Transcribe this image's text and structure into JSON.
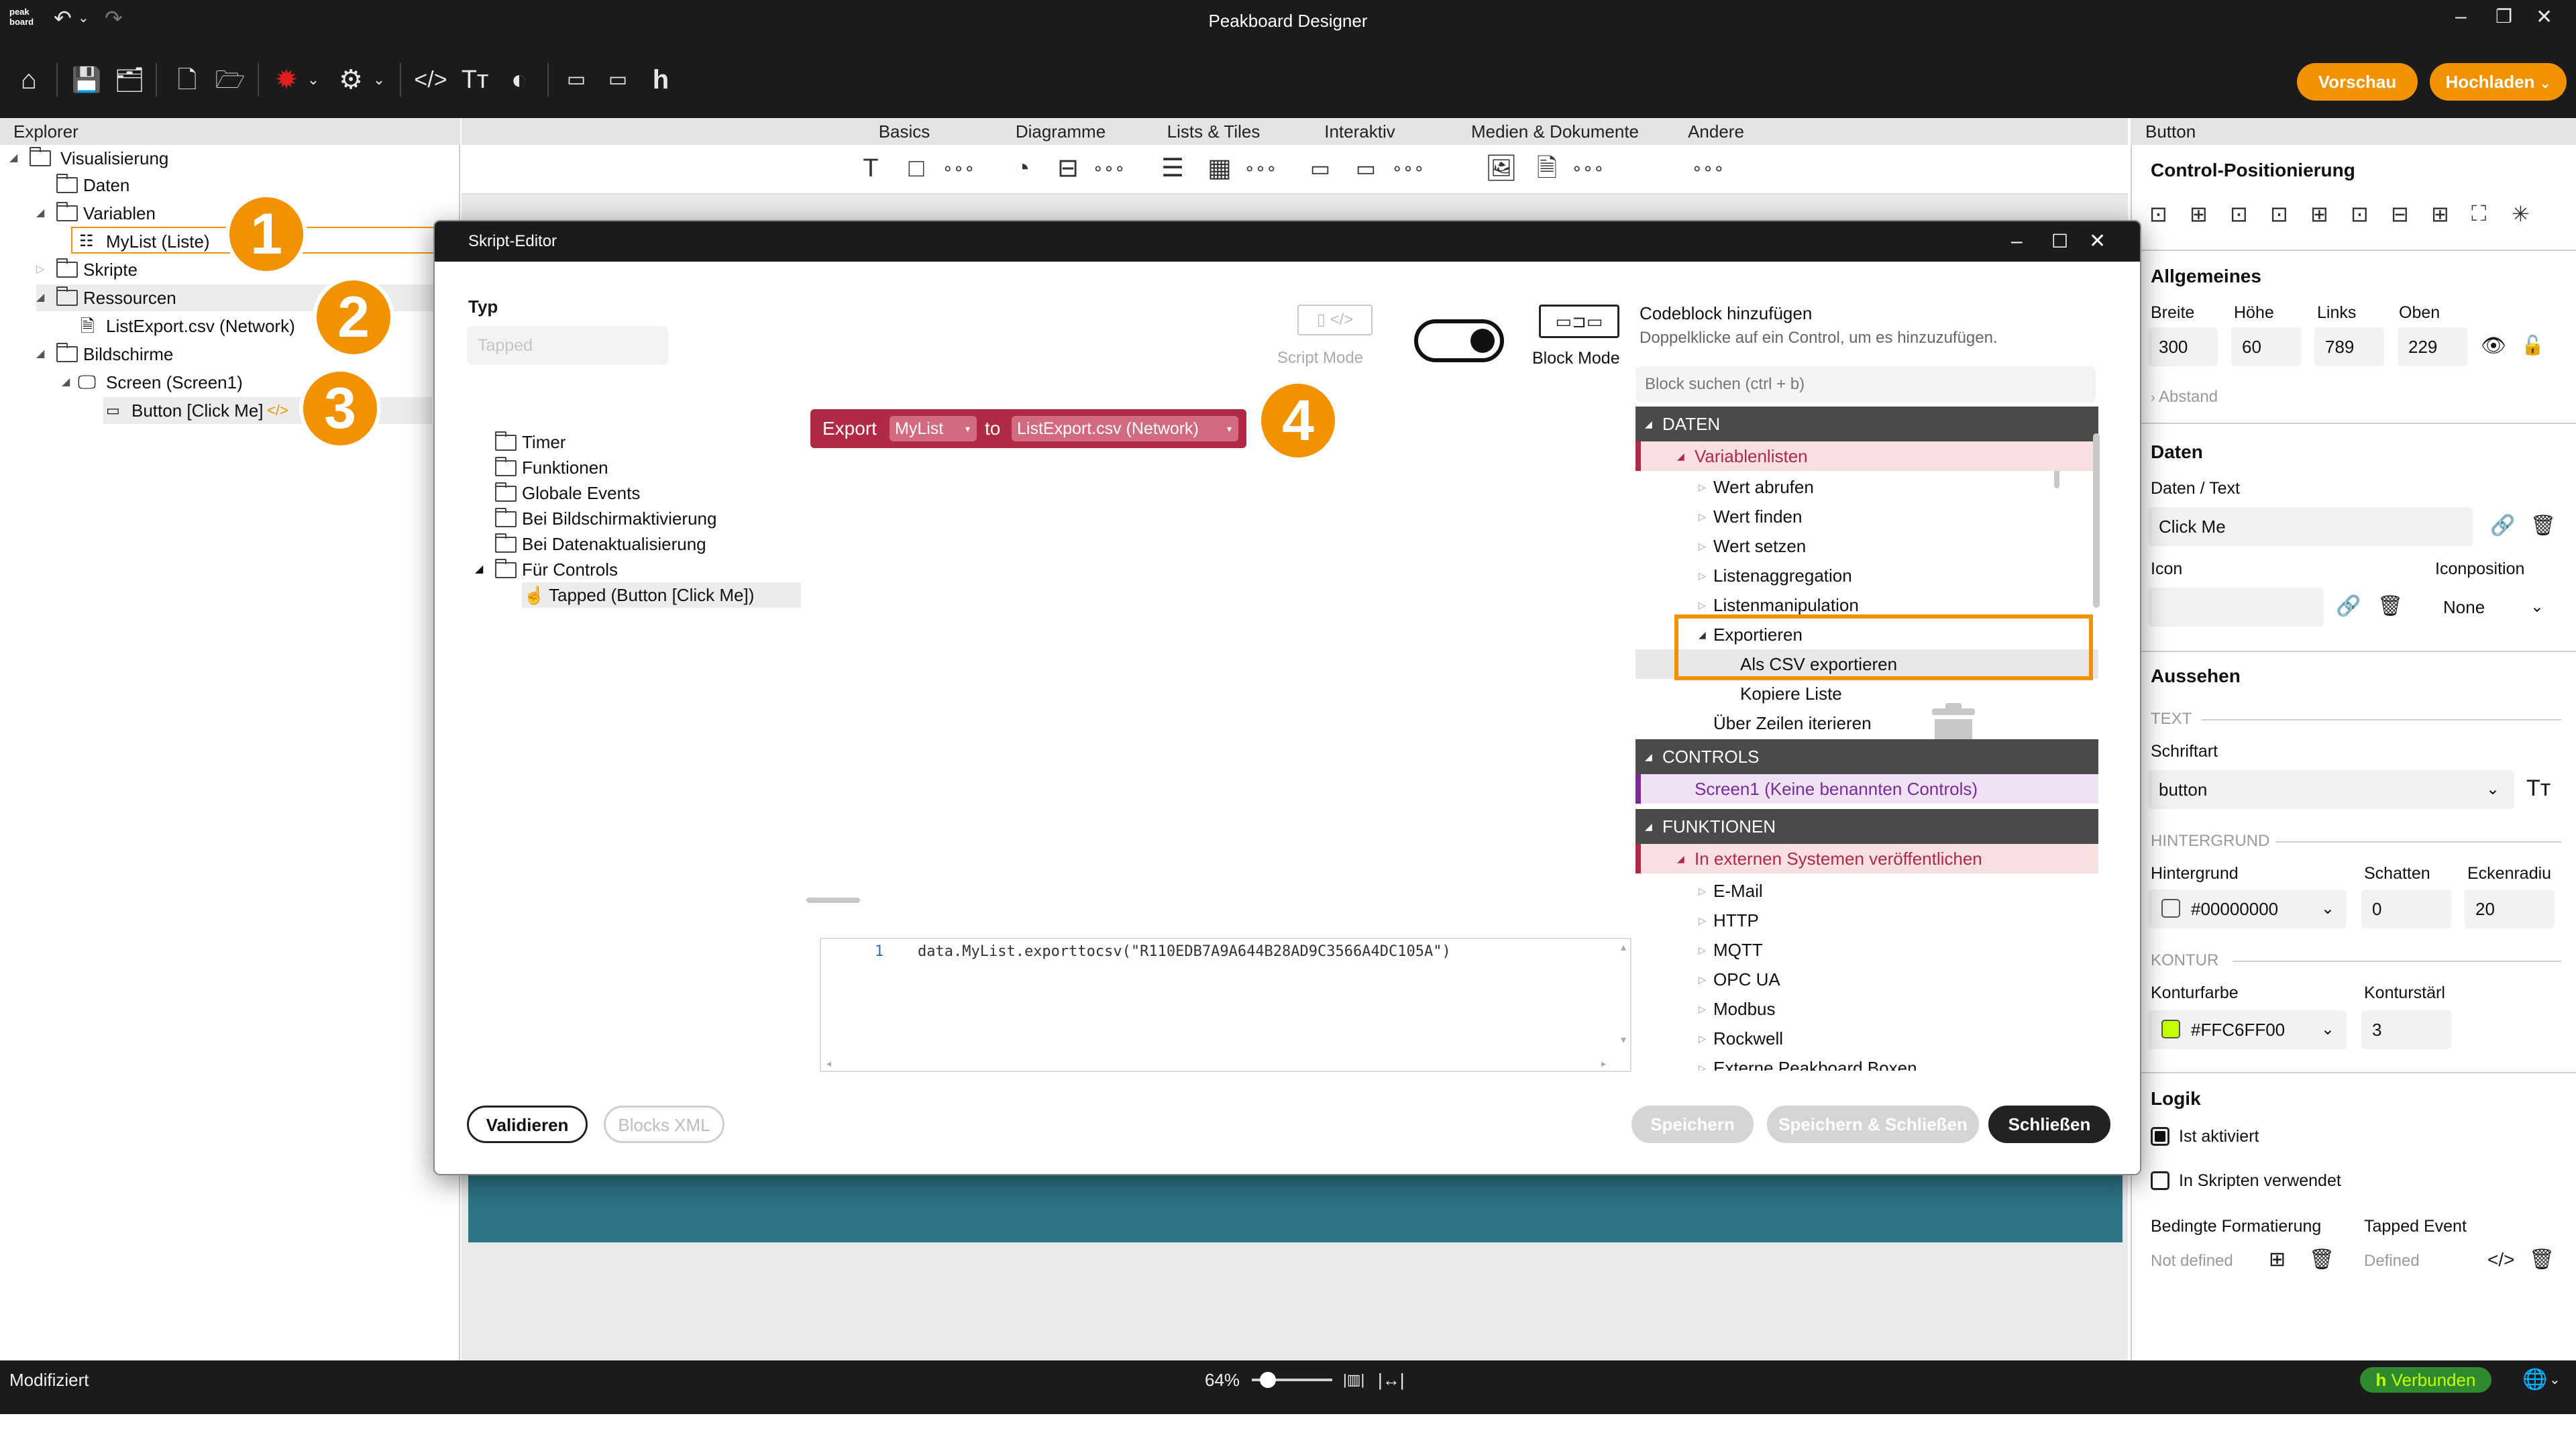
{
  "app": {
    "logo_text": "peak board",
    "title": "Peakboard Designer",
    "preview_label": "Vorschau",
    "upload_label": "Hochladen"
  },
  "explorer": {
    "header": "Explorer",
    "items": [
      {
        "label": "Visualisierung"
      },
      {
        "label": "Daten"
      },
      {
        "label": "Variablen"
      },
      {
        "label": "MyList (Liste)"
      },
      {
        "label": "Skripte"
      },
      {
        "label": "Ressourcen"
      },
      {
        "label": "ListExport.csv (Network)"
      },
      {
        "label": "Bildschirme"
      },
      {
        "label": "Screen (Screen1)"
      },
      {
        "label": "Button [Click Me]"
      }
    ],
    "markers": [
      "1",
      "2",
      "3"
    ]
  },
  "canvas_tabs": [
    "Basics",
    "Diagramme",
    "Lists & Tiles",
    "Interaktiv",
    "Medien & Dokumente",
    "Andere"
  ],
  "right_panel": {
    "header": "Button",
    "positioning_title": "Control-Positionierung",
    "general_title": "Allgemeines",
    "width_label": "Breite",
    "width": "300",
    "height_label": "Höhe",
    "height": "60",
    "left_label": "Links",
    "left": "789",
    "top_label": "Oben",
    "top": "229",
    "spacing_label": "Abstand",
    "data_title": "Daten",
    "data_text_label": "Daten / Text",
    "data_text": "Click Me",
    "icon_label": "Icon",
    "icon_position_label": "Iconposition",
    "icon_position": "None",
    "look_title": "Aussehen",
    "text_section": "TEXT",
    "font_label": "Schriftart",
    "font_value": "button",
    "bg_section": "HINTERGRUND",
    "bg_label": "Hintergrund",
    "bg_value": "#00000000",
    "shadow_label": "Schatten",
    "shadow_value": "0",
    "radius_label": "Eckenradiu",
    "radius_value": "20",
    "contour_section": "KONTUR",
    "contour_color_label": "Konturfarbe",
    "contour_color_value": "#FFC6FF00",
    "contour_width_label": "Konturstärl",
    "contour_width_value": "3",
    "logic_title": "Logik",
    "is_active": "Ist aktiviert",
    "in_scripts": "In Skripten verwendet",
    "cond_format_label": "Bedingte Formatierung",
    "cond_format_value": "Not defined",
    "tapped_event_label": "Tapped Event",
    "tapped_event_value": "Defined"
  },
  "status": {
    "left": "Modifiziert",
    "zoom": "64%",
    "connected": "Verbunden"
  },
  "script_editor": {
    "title": "Skript-Editor",
    "type_label": "Typ",
    "type_value": "Tapped",
    "script_mode": "Script Mode",
    "block_mode": "Block Mode",
    "add_block_title": "Codeblock hinzufügen",
    "add_block_hint": "Doppelklicke auf ein Control, um es hinzuzufügen.",
    "search_placeholder": "Block suchen (ctrl + b)",
    "event_tree": [
      "Timer",
      "Funktionen",
      "Globale Events",
      "Bei Bildschirmaktivierung",
      "Bei Datenaktualisierung",
      "Für Controls",
      "Tapped (Button [Click Me])"
    ],
    "block": {
      "keyword": "Export",
      "list": "MyList",
      "to": "to",
      "target": "ListExport.csv (Network)"
    },
    "marker4": "4",
    "code_line_no": "1",
    "code": "data.MyList.exporttocsv(\"R110EDB7A9A644B28AD9C3566A4DC105A\")",
    "categories": {
      "data": "DATEN",
      "variable_lists": "Variablenlisten",
      "data_items": [
        "Wert abrufen",
        "Wert finden",
        "Wert setzen",
        "Listenaggregation",
        "Listenmanipulation"
      ],
      "export": "Exportieren",
      "export_csv": "Als CSV exportieren",
      "copy_list": "Kopiere Liste",
      "iterate": "Über Zeilen iterieren",
      "controls": "CONTROLS",
      "screen1": "Screen1 (Keine benannten Controls)",
      "functions": "FUNKTIONEN",
      "publish": "In externen Systemen veröffentlichen",
      "publish_items": [
        "E-Mail",
        "HTTP",
        "MQTT",
        "OPC UA",
        "Modbus",
        "Rockwell",
        "Externe Peakboard Boxen"
      ]
    },
    "validate": "Validieren",
    "blocks_xml": "Blocks XML",
    "save": "Speichern",
    "save_close": "Speichern & Schließen",
    "close": "Schließen"
  },
  "colors": {
    "accent": "#f39200",
    "dark": "#1b1b1b",
    "block": "#b12a45",
    "connected": "#2f8a2f",
    "highlight": "#f39200"
  }
}
